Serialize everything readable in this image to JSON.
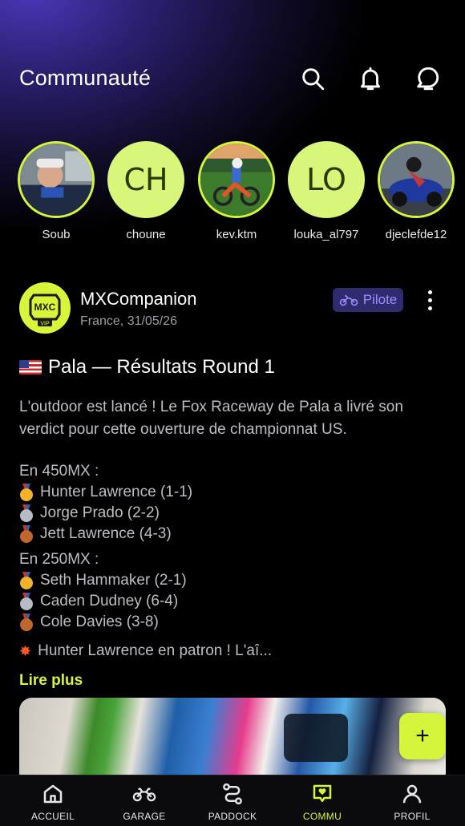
{
  "header": {
    "title": "Communauté",
    "icons": [
      "search-icon",
      "bell-icon",
      "chat-icon"
    ]
  },
  "stories": [
    {
      "username": "Soub",
      "type": "photo"
    },
    {
      "username": "choune",
      "type": "initials",
      "initials": "CH"
    },
    {
      "username": "kev.ktm",
      "type": "photo"
    },
    {
      "username": "louka_al797",
      "type": "initials",
      "initials": "LO"
    },
    {
      "username": "djeclefde12",
      "type": "photo"
    }
  ],
  "post": {
    "author": "MXCompanion",
    "avatar_text": "MXC",
    "avatar_badge": "VIP",
    "meta": "France, 31/05/26",
    "role_badge": "Pilote",
    "title": "Pala — Résultats Round 1",
    "intro": "L'outdoor est lancé ! Le Fox Raceway de Pala a livré son verdict pour cette ouverture de championnat US.",
    "class_450": "En 450MX :",
    "results_450": [
      {
        "medal": "gold",
        "text": "Hunter Lawrence (1-1)"
      },
      {
        "medal": "silver",
        "text": "Jorge Prado (2-2)"
      },
      {
        "medal": "bronze",
        "text": "Jett Lawrence (4-3)"
      }
    ],
    "class_250": "En 250MX :",
    "results_250": [
      {
        "medal": "gold",
        "text": "Seth Hammaker (2-1)"
      },
      {
        "medal": "silver",
        "text": "Caden Dudney (6-4)"
      },
      {
        "medal": "bronze",
        "text": "Cole Davies (3-8)"
      }
    ],
    "teaser": "Hunter Lawrence en patron ! L'aî...",
    "read_more": "Lire plus"
  },
  "fab_label": "+",
  "nav": [
    {
      "label": "ACCUEIL",
      "icon": "home-icon",
      "active": false
    },
    {
      "label": "GARAGE",
      "icon": "motorcycle-icon",
      "active": false
    },
    {
      "label": "PADDOCK",
      "icon": "route-icon",
      "active": false
    },
    {
      "label": "COMMU",
      "icon": "community-chat-icon",
      "active": true
    },
    {
      "label": "PROFIL",
      "icon": "user-icon",
      "active": false
    }
  ],
  "colors": {
    "accent": "#d4f53c",
    "badge_bg": "#2e2b6e",
    "badge_text": "#a08cff",
    "background": "#000000"
  }
}
